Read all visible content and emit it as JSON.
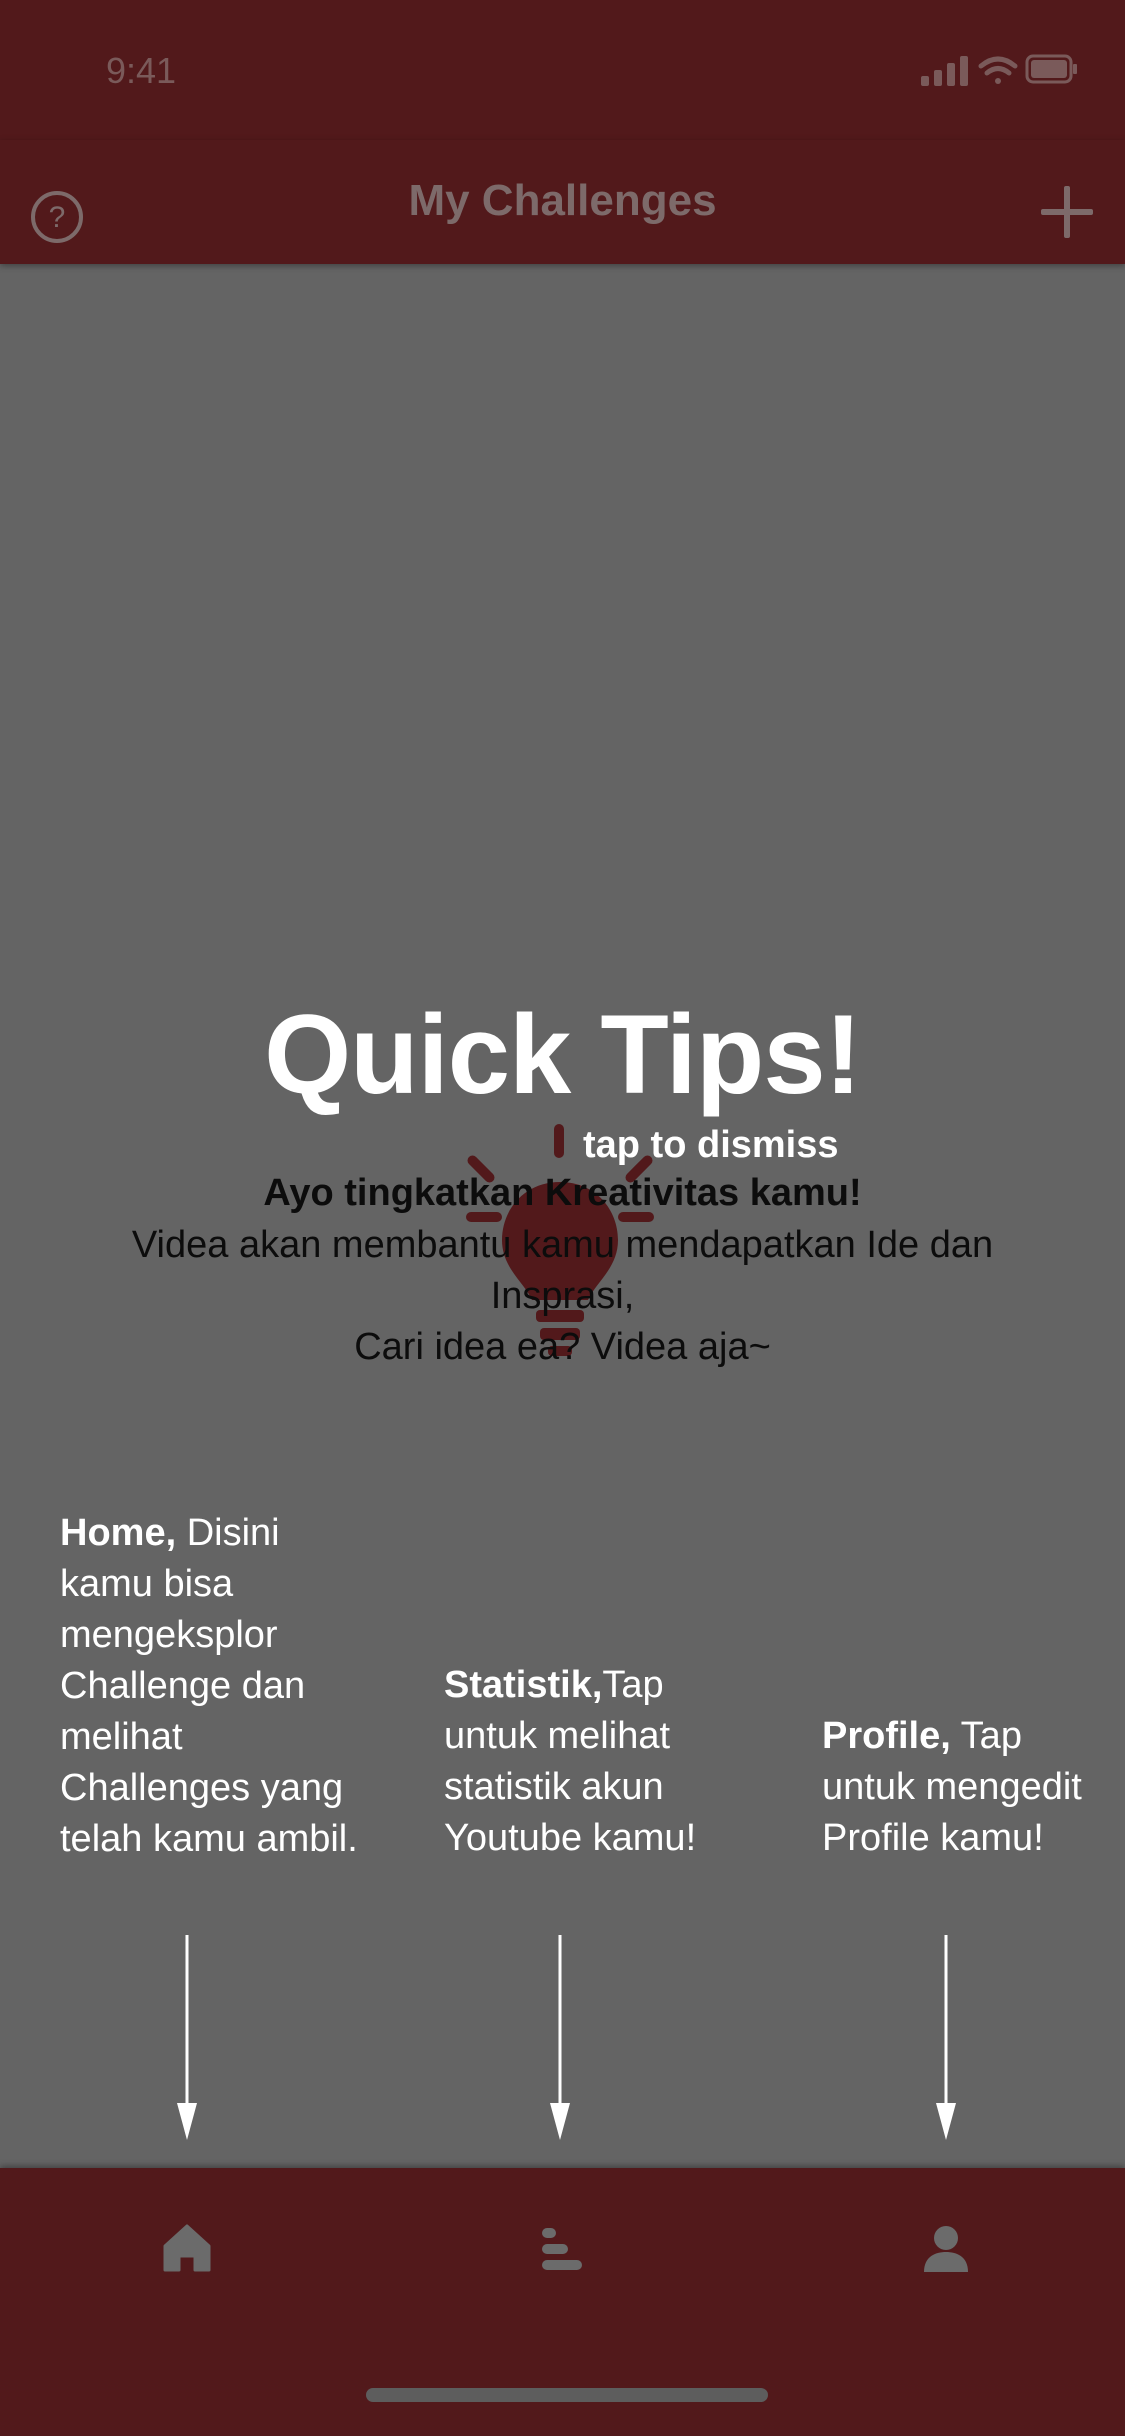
{
  "status_bar": {
    "time": "9:41"
  },
  "nav": {
    "title": "My Challenges",
    "help_icon": "help-circle-icon",
    "add_icon": "plus-icon"
  },
  "overlay": {
    "title": "Quick Tips!",
    "dismiss": "tap to dismiss",
    "headline": "Ayo tingkatkan Kreativitas kamu!",
    "body_line1": "Videa akan membantu kamu mendapatkan Ide dan Insprasi,",
    "body_line2": "Cari idea ea? Videa aja~",
    "icon": "lightbulb-icon",
    "tips": [
      {
        "bold": "Home,",
        "text": " Disini kamu bisa mengeksplor Challenge dan melihat Challenges yang telah kamu ambil."
      },
      {
        "bold": "Statistik,",
        "text": "Tap untuk melihat statistik akun Youtube kamu!"
      },
      {
        "bold": "Profile,",
        "text": " Tap untuk mengedit Profile kamu!"
      }
    ]
  },
  "tab_bar": {
    "items": [
      {
        "icon": "home-icon"
      },
      {
        "icon": "statistics-icon"
      },
      {
        "icon": "profile-icon"
      }
    ]
  },
  "colors": {
    "brand": "#52191b",
    "overlay": "#646464",
    "text_light": "#ffffff"
  }
}
